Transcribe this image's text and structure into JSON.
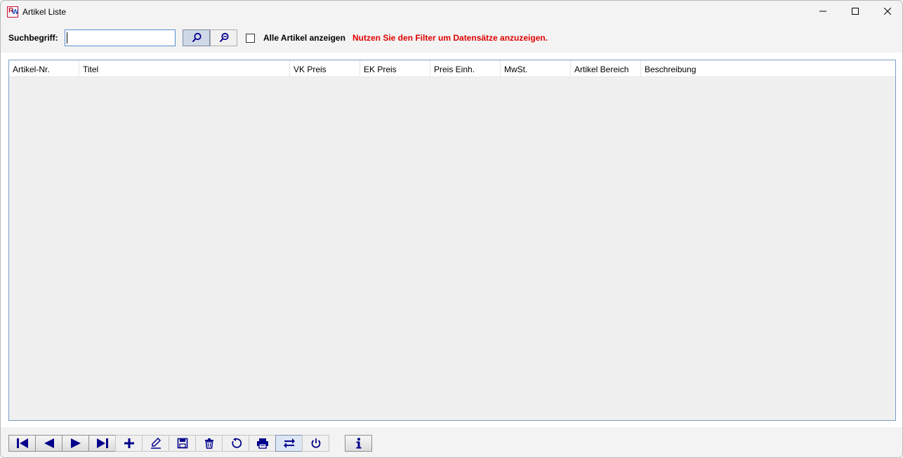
{
  "window": {
    "title": "Artikel Liste",
    "icon": "app-logo-icon",
    "logo_text_r": "R",
    "logo_text_w": "W"
  },
  "toolbar": {
    "search_label": "Suchbegriff:",
    "search_value": "",
    "search_icon": "search-icon",
    "zoom_out_icon": "zoom-out-icon",
    "show_all_label": "Alle Artikel anzeigen",
    "show_all_checked": false,
    "hint": "Nutzen Sie den Filter um Datensätze anzuzeigen.",
    "hint_color": "#e00000"
  },
  "grid": {
    "columns": [
      "Artikel-Nr.",
      "Titel",
      "VK Preis",
      "EK Preis",
      "Preis Einh.",
      "MwSt.",
      "Artikel Bereich",
      "Beschreibung"
    ],
    "rows": []
  },
  "navbar": {
    "buttons": [
      {
        "icon": "first-record-icon"
      },
      {
        "icon": "previous-record-icon"
      },
      {
        "icon": "next-record-icon"
      },
      {
        "icon": "last-record-icon"
      },
      {
        "icon": "add-icon"
      },
      {
        "icon": "edit-icon"
      },
      {
        "icon": "save-icon"
      },
      {
        "icon": "delete-icon"
      },
      {
        "icon": "refresh-icon"
      },
      {
        "icon": "print-icon"
      },
      {
        "icon": "switch-icon"
      },
      {
        "icon": "power-icon"
      },
      {
        "icon": "info-icon"
      }
    ],
    "icon_color": "#00008b"
  }
}
